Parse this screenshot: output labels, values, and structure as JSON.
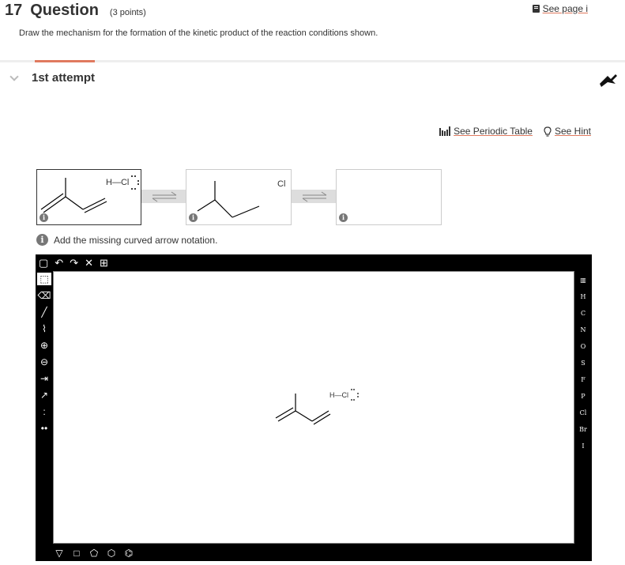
{
  "question": {
    "number": "17",
    "title": "Question",
    "points": "(3 points)",
    "see_page": "See page i",
    "instruction": "Draw the mechanism for the formation of the kinetic product of the reaction conditions shown."
  },
  "attempt": {
    "label": "1st attempt"
  },
  "tools": {
    "periodic_table": "See Periodic Table",
    "hint": "See Hint"
  },
  "mechanism": {
    "step1_reagent": "H—Cl",
    "step2_label": "Cl",
    "info_glyph": "i"
  },
  "hint_message": "Add the missing curved arrow notation.",
  "editor": {
    "top_tools": [
      "new-doc",
      "undo",
      "redo",
      "clear",
      "2d-template"
    ],
    "left_tools": [
      "select",
      "erase",
      "bond",
      "chain",
      "plus-charge",
      "minus-charge",
      "arrow",
      "mechanism-arrow",
      "radical",
      "lone-pair"
    ],
    "elements": [
      "H",
      "C",
      "N",
      "O",
      "S",
      "F",
      "P",
      "Cl",
      "Br",
      "I"
    ],
    "shapes": [
      "cyclopropane",
      "cyclobutane",
      "cyclopentane",
      "cyclohexane",
      "benzene"
    ],
    "canvas_reagent": "H—Cl"
  }
}
